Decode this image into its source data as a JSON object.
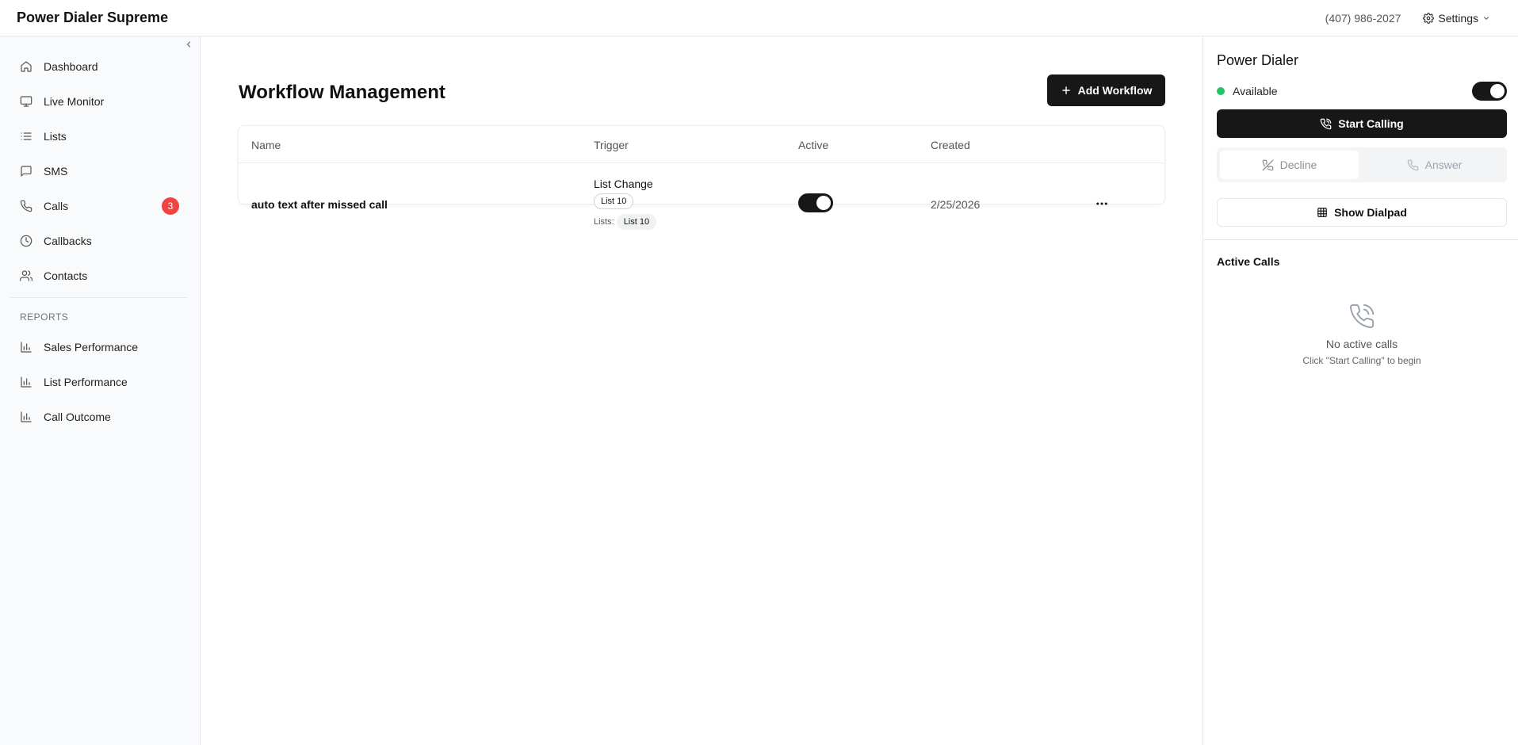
{
  "app": {
    "title": "Power Dialer Supreme",
    "phone": "(407) 986-2027",
    "settings_label": "Settings"
  },
  "sidebar": {
    "items": [
      {
        "label": "Dashboard",
        "icon": "home-icon"
      },
      {
        "label": "Live Monitor",
        "icon": "monitor-icon"
      },
      {
        "label": "Lists",
        "icon": "list-icon"
      },
      {
        "label": "SMS",
        "icon": "message-icon"
      },
      {
        "label": "Calls",
        "icon": "phone-icon",
        "badge": "3"
      },
      {
        "label": "Callbacks",
        "icon": "clock-icon"
      },
      {
        "label": "Contacts",
        "icon": "users-icon"
      }
    ],
    "reports_heading": "REPORTS",
    "reports": [
      {
        "label": "Sales Performance",
        "icon": "bar-chart-icon"
      },
      {
        "label": "List Performance",
        "icon": "bar-chart-icon"
      },
      {
        "label": "Call Outcome",
        "icon": "bar-chart-icon"
      }
    ],
    "badge_color": "#ef4444"
  },
  "main": {
    "title": "Workflow Management",
    "add_button": "Add Workflow",
    "table": {
      "headers": [
        "Name",
        "Trigger",
        "Active",
        "Created"
      ],
      "rows": [
        {
          "name": "auto text after missed call",
          "trigger_type": "List Change",
          "trigger_tag": "List 10",
          "lists_label": "Lists:",
          "list_tag": "List 10",
          "active": true,
          "created": "2/25/2026"
        }
      ]
    }
  },
  "dialer": {
    "title": "Power Dialer",
    "status": "Available",
    "status_color": "#22c55e",
    "available_toggle": true,
    "start_button": "Start Calling",
    "decline_button": "Decline",
    "answer_button": "Answer",
    "dialpad_button": "Show Dialpad",
    "active_calls_title": "Active Calls",
    "empty_title": "No active calls",
    "empty_sub": "Click \"Start Calling\" to begin"
  }
}
